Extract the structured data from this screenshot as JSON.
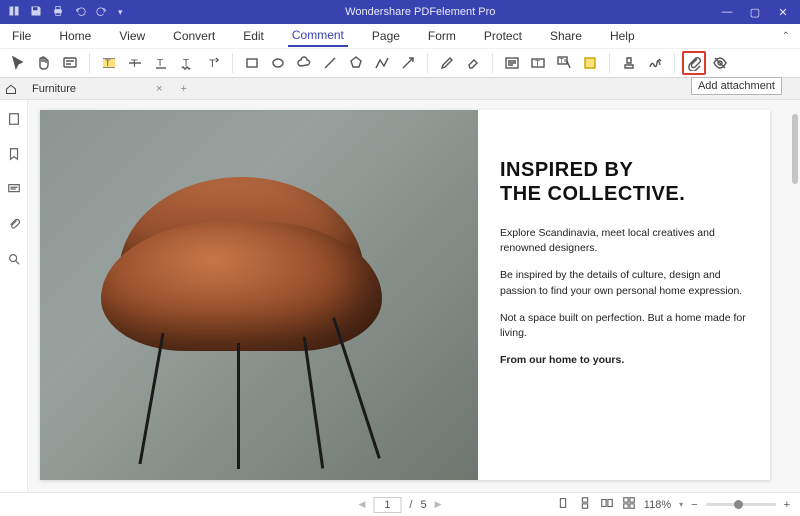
{
  "app": {
    "title": "Wondershare PDFelement Pro"
  },
  "menubar": {
    "items": [
      "File",
      "Home",
      "View",
      "Convert",
      "Edit",
      "Comment",
      "Page",
      "Form",
      "Protect",
      "Share",
      "Help"
    ],
    "active_index": 5
  },
  "tooltip": {
    "add_attachment": "Add attachment"
  },
  "tabs": {
    "items": [
      {
        "label": "Furniture"
      }
    ],
    "close_glyph": "×",
    "add_glyph": "+"
  },
  "document": {
    "headline_line1": "INSPIRED BY",
    "headline_line2": "THE COLLECTIVE.",
    "para1": "Explore Scandinavia, meet local creatives and renowned designers.",
    "para2": "Be inspired by the details of culture, design and passion to find your own personal home expression.",
    "para3": "Not a space built on perfection. But a home made for living.",
    "para4": "From our home to yours."
  },
  "status": {
    "prev_glyph": "◀",
    "next_glyph": "▶",
    "page_current": "1",
    "page_sep": "/",
    "page_total": "5",
    "zoom_value": "118%",
    "zoom_minus": "−",
    "zoom_plus": "+"
  }
}
